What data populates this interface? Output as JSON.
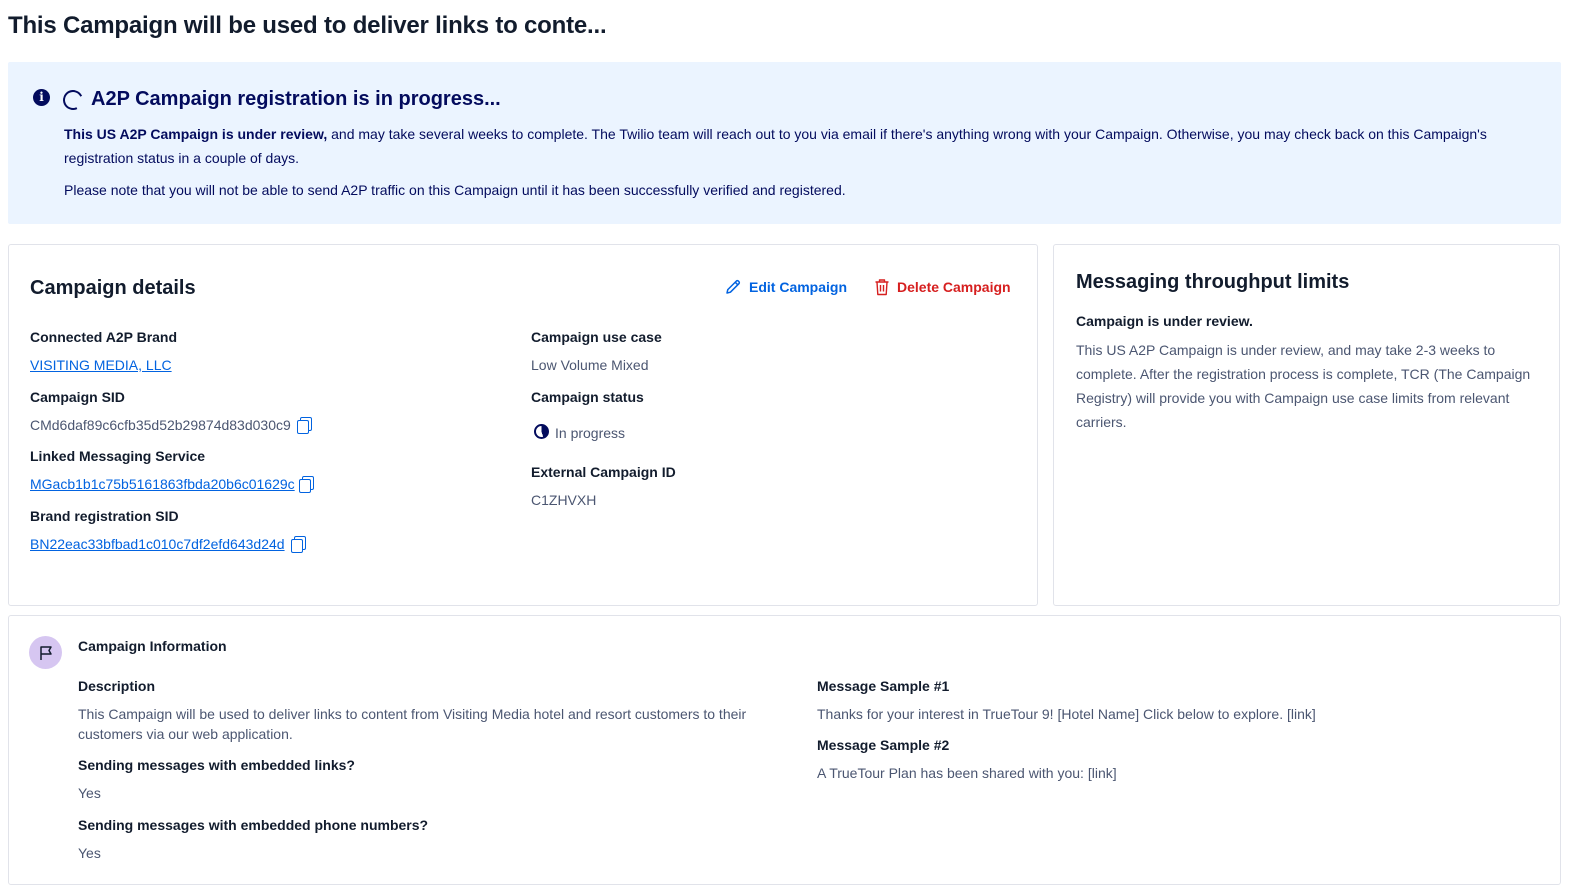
{
  "page": {
    "title": "This Campaign will be used to deliver links to conte..."
  },
  "alert": {
    "icon": "info-icon",
    "title": "A2P Campaign registration is in progress...",
    "body_bold": "This US A2P Campaign is under review,",
    "body_rest": " and may take several weeks to complete. The Twilio team will reach out to you via email if there's anything wrong with your Campaign. Otherwise, you may check back on this Campaign's registration status in a couple of days.",
    "note": "Please note that you will not be able to send A2P traffic on this Campaign until it has been successfully verified and registered."
  },
  "details": {
    "heading": "Campaign details",
    "edit_label": "Edit Campaign",
    "delete_label": "Delete Campaign",
    "brand_label": "Connected A2P Brand",
    "brand_value": "VISITING MEDIA, LLC",
    "sid_label": "Campaign SID",
    "sid_value": "CMd6daf89c6cfb35d52b29874d83d030c9",
    "messaging_label": "Linked Messaging Service",
    "messaging_value": "MGacb1b1c75b5161863fbda20b6c01629c",
    "brand_sid_label": "Brand registration SID",
    "brand_sid_value": "BN22eac33bfbad1c010c7df2efd643d24d",
    "use_case_label": "Campaign use case",
    "use_case_value": "Low Volume Mixed",
    "status_label": "Campaign status",
    "status_value": "In progress",
    "external_id_label": "External Campaign ID",
    "external_id_value": "C1ZHVXH"
  },
  "throughput": {
    "heading": "Messaging throughput limits",
    "subheading": "Campaign is under review.",
    "body": "This US A2P Campaign is under review, and may take 2-3 weeks to complete. After the registration process is complete, TCR (The Campaign Registry) will provide you with Campaign use case limits from relevant carriers."
  },
  "info": {
    "heading": "Campaign Information",
    "description_label": "Description",
    "description_value": "This Campaign will be used to deliver links to content from Visiting Media hotel and resort customers to their customers via our web application.",
    "links_label": "Sending messages with embedded links?",
    "links_value": "Yes",
    "phones_label": "Sending messages with embedded phone numbers?",
    "phones_value": "Yes",
    "sample1_label": "Message Sample #1",
    "sample1_value": "Thanks for your interest in TrueTour 9! [Hotel Name] Click below to explore. [link]",
    "sample2_label": "Message Sample #2",
    "sample2_value": "A TrueTour Plan has been shared with you: [link]"
  },
  "colors": {
    "accent": "#0263e0",
    "danger": "#d61f1f",
    "alert_bg": "#ebf4ff",
    "alert_text": "#030b5d"
  }
}
